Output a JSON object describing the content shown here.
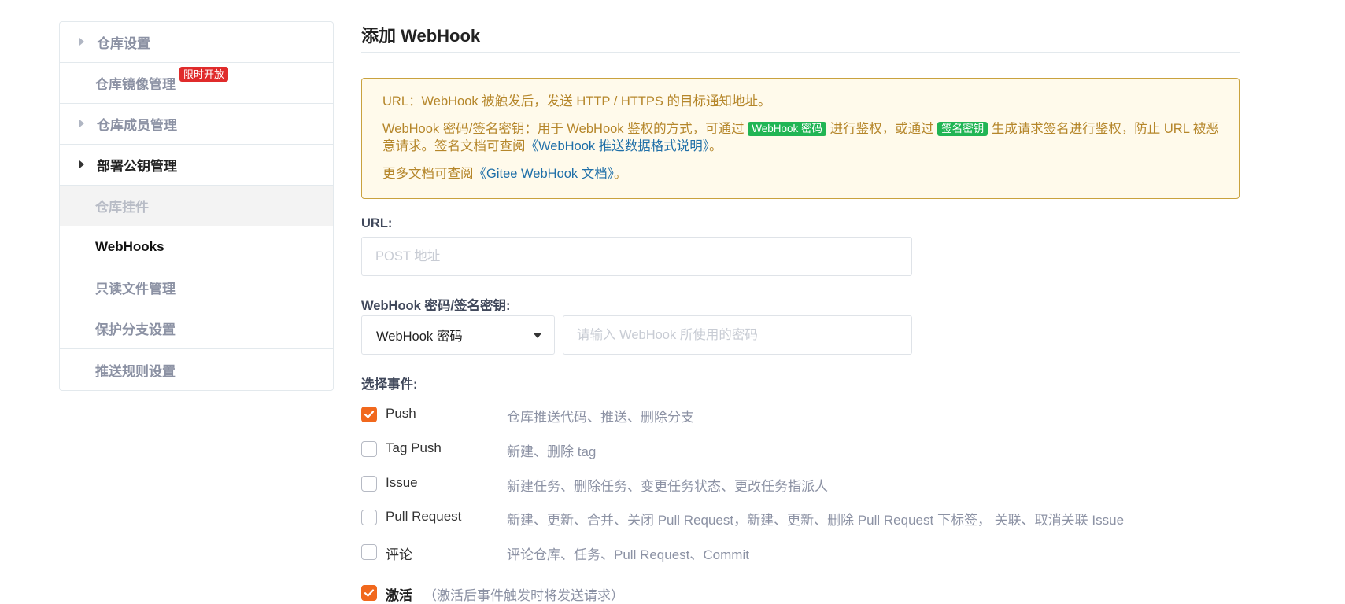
{
  "sidebar": {
    "items": [
      {
        "label": "仓库设置"
      },
      {
        "label": "仓库镜像管理",
        "badge": "限时开放"
      },
      {
        "label": "仓库成员管理"
      },
      {
        "label": "部署公钥管理"
      },
      {
        "label": "仓库挂件"
      },
      {
        "label": "WebHooks"
      },
      {
        "label": "只读文件管理"
      },
      {
        "label": "保护分支设置"
      },
      {
        "label": "推送规则设置"
      }
    ]
  },
  "main": {
    "title": "添加 WebHook",
    "notice": {
      "line1": "URL：WebHook 被触发后，发送 HTTP / HTTPS 的目标通知地址。",
      "line2_a": "WebHook 密码/签名密钥：用于 WebHook 鉴权的方式，可通过",
      "tag1": "WebHook 密码",
      "line2_b": "进行鉴权，或通过",
      "tag2": "签名密钥",
      "line2_c": "生成请求签名进行鉴权，防止 URL 被恶意请求。签名文档可查阅",
      "link1": "《WebHook 推送数据格式说明》",
      "line2_d": "。",
      "line3_a": "更多文档可查阅",
      "link2": "《Gitee WebHook 文档》",
      "line3_b": "。"
    },
    "url": {
      "label": "URL:",
      "placeholder": "POST 地址",
      "value": ""
    },
    "secret": {
      "label": "WebHook 密码/签名密钥:",
      "select_value": "WebHook 密码",
      "placeholder": "请输入 WebHook 所使用的密码",
      "value": ""
    },
    "events": {
      "label": "选择事件:",
      "items": [
        {
          "name": "Push",
          "desc": "仓库推送代码、推送、删除分支",
          "checked": true
        },
        {
          "name": "Tag Push",
          "desc": "新建、删除 tag",
          "checked": false
        },
        {
          "name": "Issue",
          "desc": "新建任务、删除任务、变更任务状态、更改任务指派人",
          "checked": false
        },
        {
          "name": "Pull Request",
          "desc": "新建、更新、合并、关闭 Pull Request，新建、更新、删除 Pull Request 下标签， 关联、取消关联 Issue",
          "checked": false
        },
        {
          "name": "评论",
          "desc": "评论仓库、任务、Pull Request、Commit",
          "checked": false
        }
      ]
    },
    "activate": {
      "label": "激活",
      "hint": "（激活后事件触发时将发送请求）",
      "checked": true
    }
  },
  "colors": {
    "accent": "#f1681d",
    "notice_bg": "#fffaeb",
    "notice_text": "#b5862a",
    "tag_green": "#21b554",
    "badge_red": "#e02b2b",
    "link": "#1f6fa8"
  }
}
